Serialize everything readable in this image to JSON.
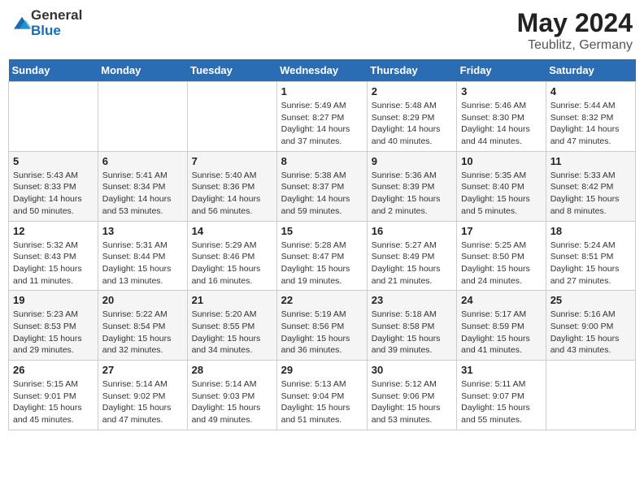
{
  "header": {
    "logo_general": "General",
    "logo_blue": "Blue",
    "month_year": "May 2024",
    "location": "Teublitz, Germany"
  },
  "days_of_week": [
    "Sunday",
    "Monday",
    "Tuesday",
    "Wednesday",
    "Thursday",
    "Friday",
    "Saturday"
  ],
  "weeks": [
    [
      {
        "day": "",
        "info": ""
      },
      {
        "day": "",
        "info": ""
      },
      {
        "day": "",
        "info": ""
      },
      {
        "day": "1",
        "info": "Sunrise: 5:49 AM\nSunset: 8:27 PM\nDaylight: 14 hours\nand 37 minutes."
      },
      {
        "day": "2",
        "info": "Sunrise: 5:48 AM\nSunset: 8:29 PM\nDaylight: 14 hours\nand 40 minutes."
      },
      {
        "day": "3",
        "info": "Sunrise: 5:46 AM\nSunset: 8:30 PM\nDaylight: 14 hours\nand 44 minutes."
      },
      {
        "day": "4",
        "info": "Sunrise: 5:44 AM\nSunset: 8:32 PM\nDaylight: 14 hours\nand 47 minutes."
      }
    ],
    [
      {
        "day": "5",
        "info": "Sunrise: 5:43 AM\nSunset: 8:33 PM\nDaylight: 14 hours\nand 50 minutes."
      },
      {
        "day": "6",
        "info": "Sunrise: 5:41 AM\nSunset: 8:34 PM\nDaylight: 14 hours\nand 53 minutes."
      },
      {
        "day": "7",
        "info": "Sunrise: 5:40 AM\nSunset: 8:36 PM\nDaylight: 14 hours\nand 56 minutes."
      },
      {
        "day": "8",
        "info": "Sunrise: 5:38 AM\nSunset: 8:37 PM\nDaylight: 14 hours\nand 59 minutes."
      },
      {
        "day": "9",
        "info": "Sunrise: 5:36 AM\nSunset: 8:39 PM\nDaylight: 15 hours\nand 2 minutes."
      },
      {
        "day": "10",
        "info": "Sunrise: 5:35 AM\nSunset: 8:40 PM\nDaylight: 15 hours\nand 5 minutes."
      },
      {
        "day": "11",
        "info": "Sunrise: 5:33 AM\nSunset: 8:42 PM\nDaylight: 15 hours\nand 8 minutes."
      }
    ],
    [
      {
        "day": "12",
        "info": "Sunrise: 5:32 AM\nSunset: 8:43 PM\nDaylight: 15 hours\nand 11 minutes."
      },
      {
        "day": "13",
        "info": "Sunrise: 5:31 AM\nSunset: 8:44 PM\nDaylight: 15 hours\nand 13 minutes."
      },
      {
        "day": "14",
        "info": "Sunrise: 5:29 AM\nSunset: 8:46 PM\nDaylight: 15 hours\nand 16 minutes."
      },
      {
        "day": "15",
        "info": "Sunrise: 5:28 AM\nSunset: 8:47 PM\nDaylight: 15 hours\nand 19 minutes."
      },
      {
        "day": "16",
        "info": "Sunrise: 5:27 AM\nSunset: 8:49 PM\nDaylight: 15 hours\nand 21 minutes."
      },
      {
        "day": "17",
        "info": "Sunrise: 5:25 AM\nSunset: 8:50 PM\nDaylight: 15 hours\nand 24 minutes."
      },
      {
        "day": "18",
        "info": "Sunrise: 5:24 AM\nSunset: 8:51 PM\nDaylight: 15 hours\nand 27 minutes."
      }
    ],
    [
      {
        "day": "19",
        "info": "Sunrise: 5:23 AM\nSunset: 8:53 PM\nDaylight: 15 hours\nand 29 minutes."
      },
      {
        "day": "20",
        "info": "Sunrise: 5:22 AM\nSunset: 8:54 PM\nDaylight: 15 hours\nand 32 minutes."
      },
      {
        "day": "21",
        "info": "Sunrise: 5:20 AM\nSunset: 8:55 PM\nDaylight: 15 hours\nand 34 minutes."
      },
      {
        "day": "22",
        "info": "Sunrise: 5:19 AM\nSunset: 8:56 PM\nDaylight: 15 hours\nand 36 minutes."
      },
      {
        "day": "23",
        "info": "Sunrise: 5:18 AM\nSunset: 8:58 PM\nDaylight: 15 hours\nand 39 minutes."
      },
      {
        "day": "24",
        "info": "Sunrise: 5:17 AM\nSunset: 8:59 PM\nDaylight: 15 hours\nand 41 minutes."
      },
      {
        "day": "25",
        "info": "Sunrise: 5:16 AM\nSunset: 9:00 PM\nDaylight: 15 hours\nand 43 minutes."
      }
    ],
    [
      {
        "day": "26",
        "info": "Sunrise: 5:15 AM\nSunset: 9:01 PM\nDaylight: 15 hours\nand 45 minutes."
      },
      {
        "day": "27",
        "info": "Sunrise: 5:14 AM\nSunset: 9:02 PM\nDaylight: 15 hours\nand 47 minutes."
      },
      {
        "day": "28",
        "info": "Sunrise: 5:14 AM\nSunset: 9:03 PM\nDaylight: 15 hours\nand 49 minutes."
      },
      {
        "day": "29",
        "info": "Sunrise: 5:13 AM\nSunset: 9:04 PM\nDaylight: 15 hours\nand 51 minutes."
      },
      {
        "day": "30",
        "info": "Sunrise: 5:12 AM\nSunset: 9:06 PM\nDaylight: 15 hours\nand 53 minutes."
      },
      {
        "day": "31",
        "info": "Sunrise: 5:11 AM\nSunset: 9:07 PM\nDaylight: 15 hours\nand 55 minutes."
      },
      {
        "day": "",
        "info": ""
      }
    ]
  ]
}
